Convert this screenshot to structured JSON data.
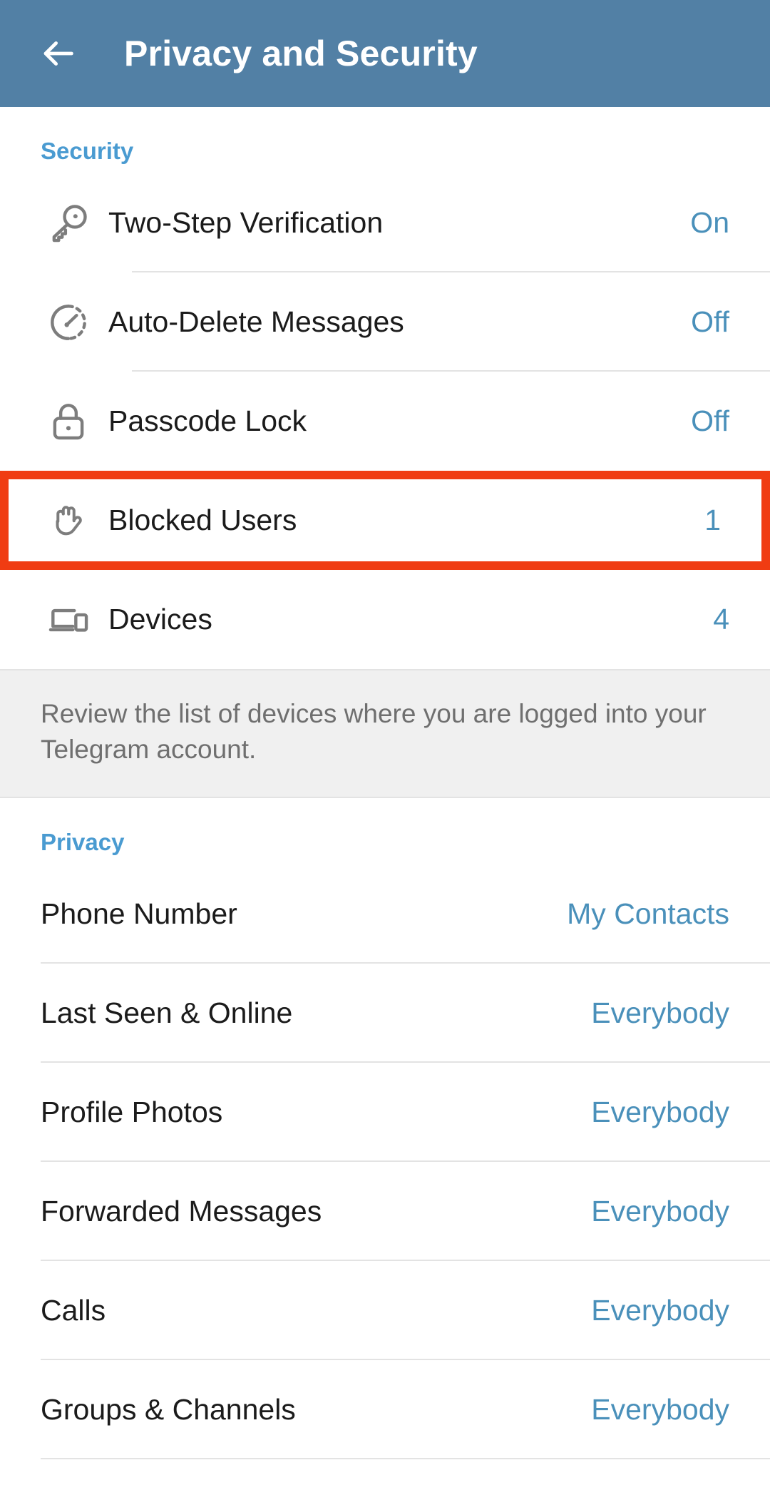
{
  "header": {
    "title": "Privacy and Security",
    "back_icon": "arrow-left-icon",
    "background_color": "#5280a5",
    "title_color": "#ffffff"
  },
  "theme": {
    "accent_blue": "#4a9bd1",
    "value_blue": "#4a90ba",
    "highlight_red": "#f03c12",
    "icon_gray": "#7d7d7d",
    "divider_gray": "#e3e3e3",
    "info_bg": "#f0f0f0",
    "info_text": "#6f6f6f",
    "label_black": "#1b1b1b"
  },
  "security": {
    "section_title": "Security",
    "rows": [
      {
        "icon": "key-icon",
        "label": "Two-Step Verification",
        "value": "On",
        "highlighted": false
      },
      {
        "icon": "auto-delete-timer-icon",
        "label": "Auto-Delete Messages",
        "value": "Off",
        "highlighted": false
      },
      {
        "icon": "padlock-icon",
        "label": "Passcode Lock",
        "value": "Off",
        "highlighted": false
      },
      {
        "icon": "hand-stop-icon",
        "label": "Blocked Users",
        "value": "1",
        "highlighted": true
      },
      {
        "icon": "devices-icon",
        "label": "Devices",
        "value": "4",
        "highlighted": false
      }
    ]
  },
  "info": {
    "text": "Review the list of devices where you are logged into your Telegram account."
  },
  "privacy": {
    "section_title": "Privacy",
    "rows": [
      {
        "label": "Phone Number",
        "value": "My Contacts"
      },
      {
        "label": "Last Seen & Online",
        "value": "Everybody"
      },
      {
        "label": "Profile Photos",
        "value": "Everybody"
      },
      {
        "label": "Forwarded Messages",
        "value": "Everybody"
      },
      {
        "label": "Calls",
        "value": "Everybody"
      },
      {
        "label": "Groups & Channels",
        "value": "Everybody"
      }
    ]
  }
}
